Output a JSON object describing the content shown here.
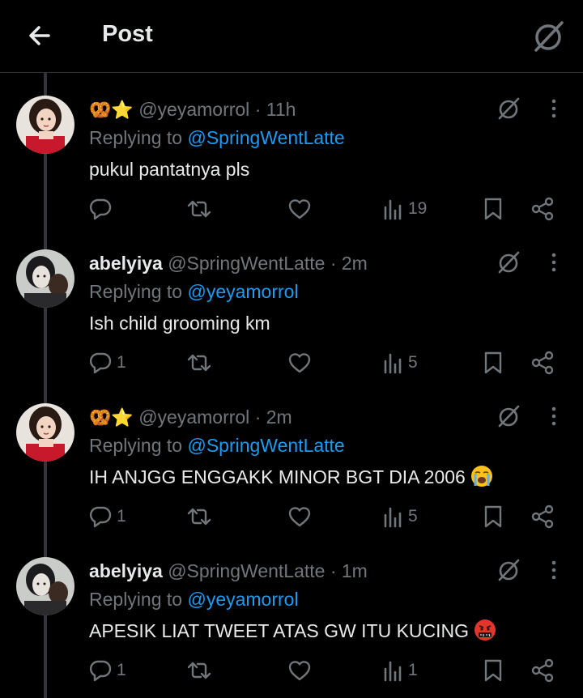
{
  "header": {
    "title": "Post"
  },
  "tweets": [
    {
      "display_name": "🥨⭐",
      "handle": "@yeyamorrol",
      "time": "· 11h",
      "replying_label": "Replying to",
      "replying_to": "@SpringWentLatte",
      "text": "pukul pantatnya pls",
      "replies": "",
      "views": "19",
      "avatar": "avatar-girl-red"
    },
    {
      "display_name": "abelyiya",
      "handle": "@SpringWentLatte",
      "time": "· 2m",
      "replying_label": "Replying to",
      "replying_to": "@yeyamorrol",
      "text": "Ish child grooming km",
      "replies": "1",
      "views": "5",
      "avatar": "avatar-boy-dark"
    },
    {
      "display_name": "🥨⭐",
      "handle": "@yeyamorrol",
      "time": "· 2m",
      "replying_label": "Replying to",
      "replying_to": "@SpringWentLatte",
      "text": "IH ANJGG ENGGAKK MINOR BGT DIA 2006",
      "text_emoji": "loudly-crying-face",
      "replies": "1",
      "views": "5",
      "avatar": "avatar-girl-red"
    },
    {
      "display_name": "abelyiya",
      "handle": "@SpringWentLatte",
      "time": "· 1m",
      "replying_label": "Replying to",
      "replying_to": "@yeyamorrol",
      "text": "APESIK LIAT TWEET ATAS GW ITU KUCING",
      "text_emoji": "face-with-symbols-on-mouth",
      "replies": "1",
      "views": "1",
      "avatar": "avatar-boy-dark"
    }
  ],
  "colors": {
    "background": "#000000",
    "text": "#e7e9ea",
    "muted": "#71767b",
    "link": "#1d9bf0",
    "divider": "#2f3336"
  }
}
